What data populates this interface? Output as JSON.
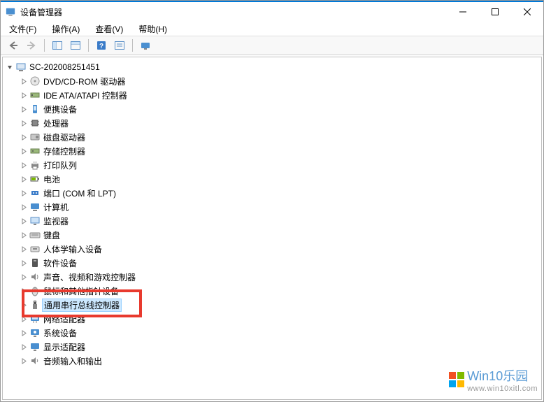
{
  "window": {
    "title": "设备管理器"
  },
  "menu": {
    "file": "文件(F)",
    "action": "操作(A)",
    "view": "查看(V)",
    "help": "帮助(H)"
  },
  "tree": {
    "root": "SC-202008251451",
    "items": [
      {
        "label": "DVD/CD-ROM 驱动器",
        "icon": "disc"
      },
      {
        "label": "IDE ATA/ATAPI 控制器",
        "icon": "ide"
      },
      {
        "label": "便携设备",
        "icon": "portable"
      },
      {
        "label": "处理器",
        "icon": "cpu"
      },
      {
        "label": "磁盘驱动器",
        "icon": "disk"
      },
      {
        "label": "存储控制器",
        "icon": "storage"
      },
      {
        "label": "打印队列",
        "icon": "printer"
      },
      {
        "label": "电池",
        "icon": "battery"
      },
      {
        "label": "端口 (COM 和 LPT)",
        "icon": "port"
      },
      {
        "label": "计算机",
        "icon": "computer"
      },
      {
        "label": "监视器",
        "icon": "monitor"
      },
      {
        "label": "键盘",
        "icon": "keyboard"
      },
      {
        "label": "人体学输入设备",
        "icon": "hid"
      },
      {
        "label": "软件设备",
        "icon": "software"
      },
      {
        "label": "声音、视频和游戏控制器",
        "icon": "sound"
      },
      {
        "label": "鼠标和其他指针设备",
        "icon": "mouse"
      },
      {
        "label": "通用串行总线控制器",
        "icon": "usb",
        "selected": true
      },
      {
        "label": "网络适配器",
        "icon": "network"
      },
      {
        "label": "系统设备",
        "icon": "system"
      },
      {
        "label": "显示适配器",
        "icon": "display"
      },
      {
        "label": "音频输入和输出",
        "icon": "audio"
      }
    ]
  },
  "watermark": {
    "brand": "Win10乐园",
    "url": "www.win10xitl.com"
  }
}
